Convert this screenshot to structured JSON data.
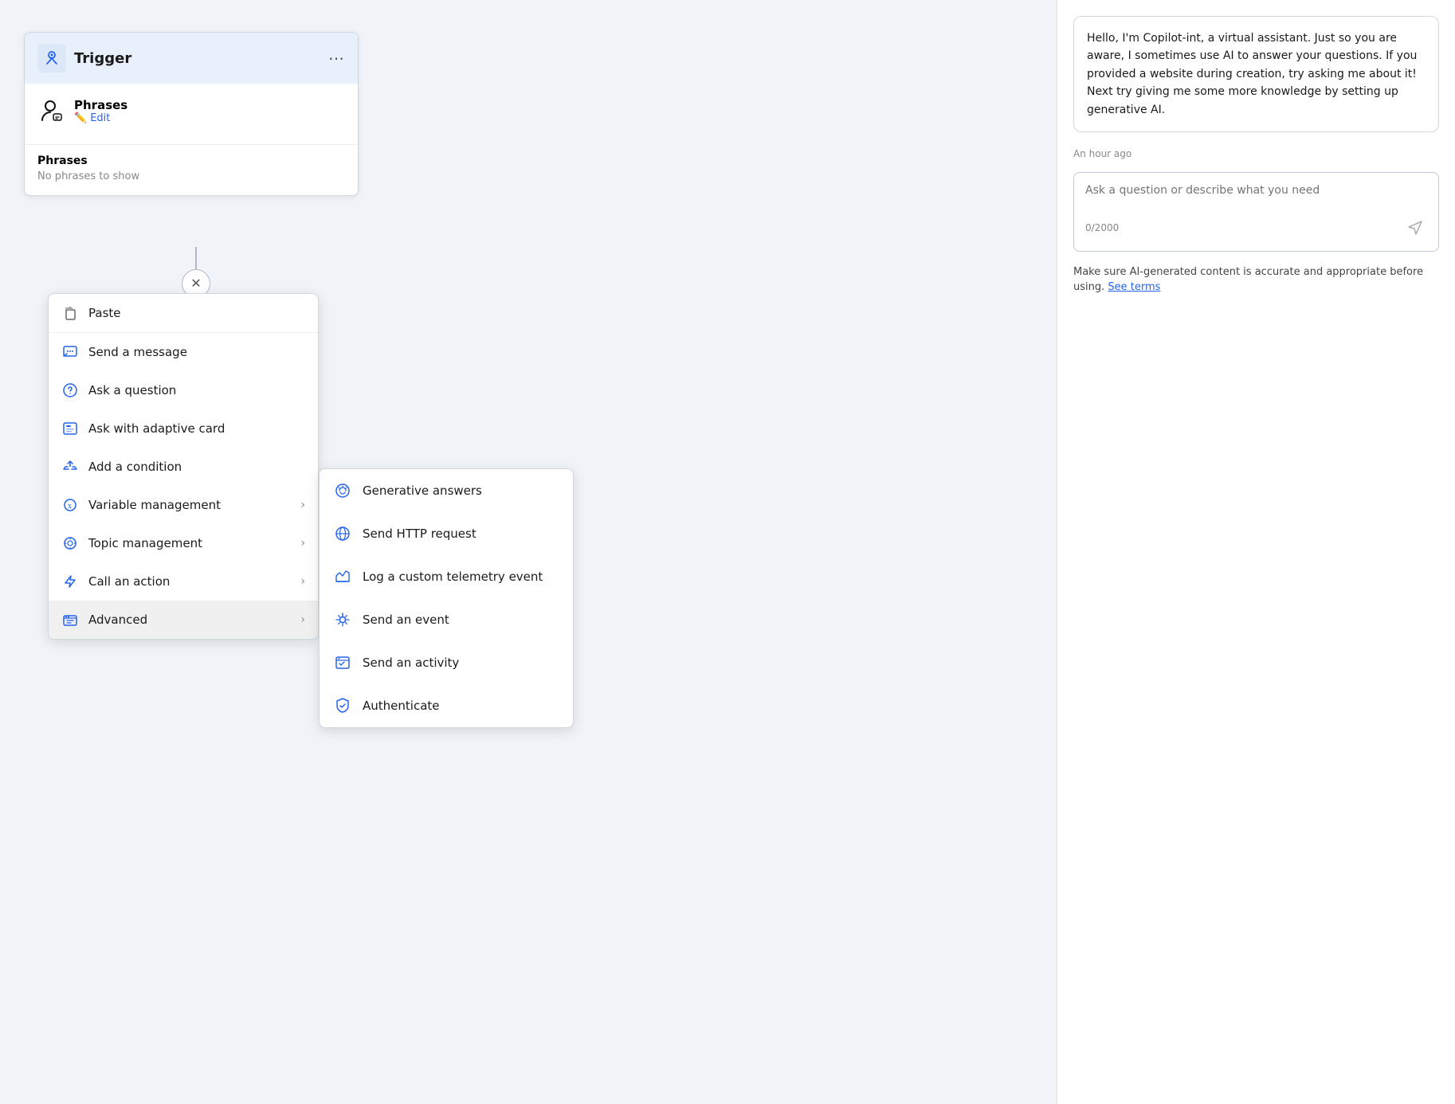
{
  "trigger": {
    "title": "Trigger",
    "menu_icon": "⋯",
    "phrases_label": "Phrases",
    "edit_label": "Edit",
    "phrases_section_label": "Phrases",
    "phrases_empty": "No phrases to show"
  },
  "menu": {
    "items": [
      {
        "id": "paste",
        "label": "Paste",
        "icon": "paste",
        "has_submenu": false
      },
      {
        "id": "send-message",
        "label": "Send a message",
        "icon": "message",
        "has_submenu": false
      },
      {
        "id": "ask-question",
        "label": "Ask a question",
        "icon": "question",
        "has_submenu": false
      },
      {
        "id": "ask-adaptive",
        "label": "Ask with adaptive card",
        "icon": "adaptive",
        "has_submenu": false
      },
      {
        "id": "add-condition",
        "label": "Add a condition",
        "icon": "condition",
        "has_submenu": false
      },
      {
        "id": "variable-management",
        "label": "Variable management",
        "icon": "variable",
        "has_submenu": true
      },
      {
        "id": "topic-management",
        "label": "Topic management",
        "icon": "topic",
        "has_submenu": true
      },
      {
        "id": "call-action",
        "label": "Call an action",
        "icon": "action",
        "has_submenu": true
      },
      {
        "id": "advanced",
        "label": "Advanced",
        "icon": "advanced",
        "has_submenu": true
      }
    ]
  },
  "submenu": {
    "items": [
      {
        "id": "generative-answers",
        "label": "Generative answers",
        "icon": "gen"
      },
      {
        "id": "send-http",
        "label": "Send HTTP request",
        "icon": "http"
      },
      {
        "id": "log-telemetry",
        "label": "Log a custom telemetry event",
        "icon": "telemetry"
      },
      {
        "id": "send-event",
        "label": "Send an event",
        "icon": "event"
      },
      {
        "id": "send-activity",
        "label": "Send an activity",
        "icon": "activity"
      },
      {
        "id": "authenticate",
        "label": "Authenticate",
        "icon": "auth"
      }
    ]
  },
  "chat": {
    "message": "Hello, I'm Copilot-int, a virtual assistant. Just so you are aware, I sometimes use AI to answer your questions. If you provided a website during creation, try asking me about it! Next try giving me some more knowledge by setting up generative AI.",
    "timestamp": "An hour ago",
    "input_placeholder": "Ask a question or describe what you need",
    "char_count": "0/2000",
    "disclaimer": "Make sure AI-generated content is accurate and appropriate before using.",
    "see_terms_label": "See terms"
  },
  "colors": {
    "blue": "#2563eb",
    "light_blue_bg": "#e8f0fb",
    "border": "#d0d7de"
  }
}
